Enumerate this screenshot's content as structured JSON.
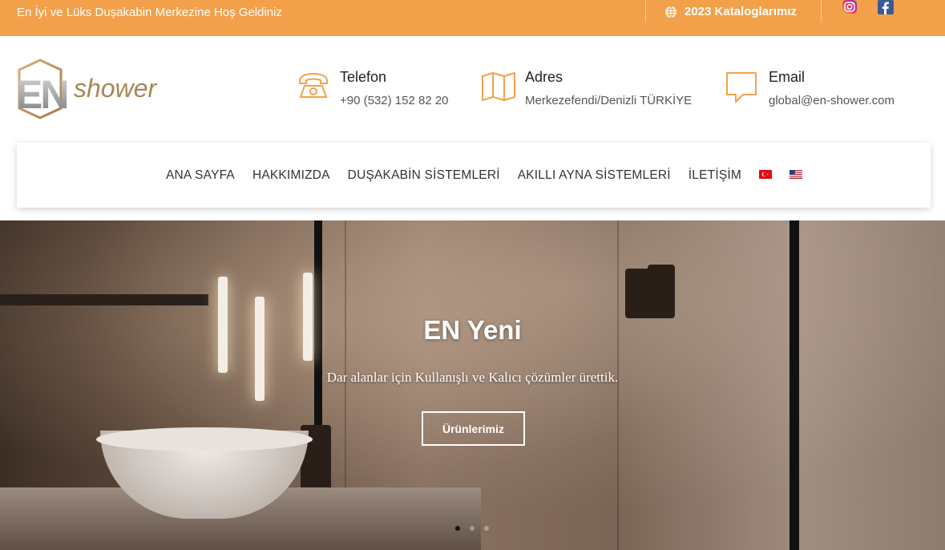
{
  "topbar": {
    "welcome": "En İyi ve Lüks Duşakabin Merkezine Hoş Geldiniz",
    "catalog_label": "2023 Kataloglarımız",
    "catalog_icon": "globe-icon",
    "socials": [
      "instagram-icon",
      "facebook-icon"
    ]
  },
  "logo": {
    "en": "EN",
    "word": "shower"
  },
  "contacts": [
    {
      "title": "Telefon",
      "value": "+90 (532) 152 82 20",
      "icon": "phone-icon"
    },
    {
      "title": "Adres",
      "value": "Merkezefendi/Denizli TÜRKİYE",
      "icon": "map-icon"
    },
    {
      "title": "Email",
      "value": "global@en-shower.com",
      "icon": "chat-icon"
    }
  ],
  "nav": {
    "items": [
      "ANA SAYFA",
      "HAKKIMIZDA",
      "DUŞAKABİN SİSTEMLERİ",
      "AKILLI AYNA SİSTEMLERİ",
      "İLETİŞİM"
    ],
    "flags": [
      "turkey-flag-icon",
      "usa-flag-icon"
    ]
  },
  "hero": {
    "title": "EN Yeni",
    "subtitle": "Dar alanlar için Kullanışlı ve Kalıcı çözümler ürettik.",
    "button": "Ürünlerimiz",
    "slide_count": 3,
    "active_slide": 1
  },
  "colors": {
    "accent": "#f2a14a",
    "text": "#222222"
  }
}
